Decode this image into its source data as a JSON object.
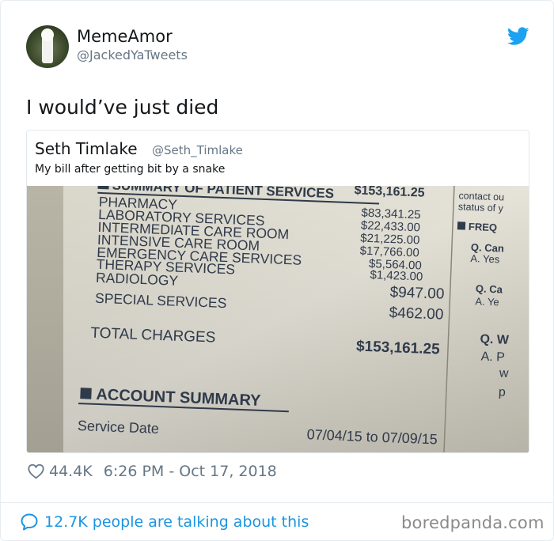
{
  "author": {
    "name": "MemeAmor",
    "handle": "@JackedYaTweets"
  },
  "tweet": {
    "text": "I would’ve just died"
  },
  "quoted_tweet": {
    "name": "Seth Timlake",
    "handle": "@Seth_Timlake",
    "text": "My bill after getting bit by a snake",
    "bill": {
      "top_cut": "$153,161.25",
      "summary_title": "SUMMARY OF PATIENT SERVICES",
      "items": [
        {
          "label": "PHARMACY",
          "amount": "$83,341.25"
        },
        {
          "label": "LABORATORY SERVICES",
          "amount": "$22,433.00"
        },
        {
          "label": "INTERMEDIATE CARE ROOM",
          "amount": "$21,225.00"
        },
        {
          "label": "INTENSIVE CARE ROOM",
          "amount": "$17,766.00"
        },
        {
          "label": "EMERGENCY CARE SERVICES",
          "amount": "$5,564.00"
        },
        {
          "label": "THERAPY SERVICES",
          "amount": "$1,423.00"
        },
        {
          "label": "RADIOLOGY",
          "amount": "$947.00"
        },
        {
          "label": "SPECIAL SERVICES",
          "amount": "$462.00"
        }
      ],
      "total_label": "TOTAL CHARGES",
      "total_amount": "$153,161.25",
      "account_title": "ACCOUNT SUMMARY",
      "service_date_label": "Service Date",
      "service_date_value": "07/04/15 to 07/09/15",
      "side_text": [
        "contact ou",
        "status of y",
        "FREQ",
        "Q. Can",
        "A. Yes",
        "Q. Ca",
        "A. Ye",
        "Q. W",
        "A. P",
        "w",
        "p"
      ]
    }
  },
  "meta": {
    "likes": "44.4K",
    "timestamp": "6:26 PM - Oct 17, 2018"
  },
  "footer": {
    "talking": "12.7K people are talking about this",
    "watermark": "boredpanda.com"
  },
  "icons": {
    "twitter": "twitter-bird-icon",
    "heart": "heart-icon",
    "bubble": "speech-bubble-icon"
  },
  "colors": {
    "twitter_blue": "#1da1f2",
    "link_blue": "#1b95e0",
    "gray_text": "#657786"
  }
}
